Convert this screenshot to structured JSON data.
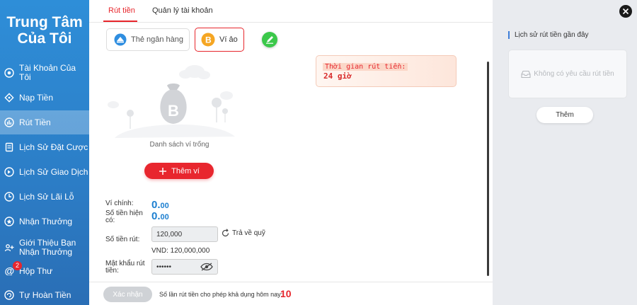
{
  "sidebar": {
    "title_line1": "Trung Tâm",
    "title_line2": "Của Tôi",
    "items": [
      {
        "label": "Tài Khoản Của Tôi",
        "icon": "account-icon"
      },
      {
        "label": "Nạp Tiền",
        "icon": "deposit-icon"
      },
      {
        "label": "Rút Tiền",
        "icon": "withdraw-icon",
        "active": true
      },
      {
        "label": "Lịch Sử Đặt Cược",
        "icon": "bet-history-icon"
      },
      {
        "label": "Lịch Sử Giao Dịch",
        "icon": "transaction-history-icon"
      },
      {
        "label": "Lịch Sử Lãi Lỗ",
        "icon": "profit-loss-icon"
      },
      {
        "label": "Nhận Thưởng",
        "icon": "reward-icon"
      },
      {
        "label": "Giới Thiệu Bạn Nhận Thưởng",
        "icon": "referral-icon"
      },
      {
        "label": "Hộp Thư",
        "icon": "mailbox-icon",
        "badge": "2"
      },
      {
        "label": "Tự Hoàn Tiền",
        "icon": "auto-refund-icon"
      }
    ]
  },
  "tabs": [
    {
      "label": "Rút tiền",
      "active": true
    },
    {
      "label": "Quản lý tài khoản"
    }
  ],
  "methods": {
    "bank_card": "Thẻ ngân hàng",
    "e_wallet": "Ví ảo"
  },
  "notice": {
    "label": "Thời gian rút tiền:",
    "value": "24 giờ"
  },
  "empty_state": {
    "text": "Danh sách ví trống",
    "add_button": "Thêm ví"
  },
  "form": {
    "main_wallet_label": "Ví chính:",
    "main_wallet_int": "0.",
    "main_wallet_dec": "00",
    "current_amount_label_1": "Số tiền hiện",
    "current_amount_label_2": "có:",
    "current_amount_int": "0.",
    "current_amount_dec": "00",
    "withdraw_label": "Số tiền rút:",
    "withdraw_value": "120,000",
    "refund_label": "Trả về quỹ",
    "vnd_text": "VND: 120,000,000",
    "password_label_1": "Mật khẩu rút",
    "password_label_2": "tiền:",
    "password_value": "••••••"
  },
  "footer": {
    "confirm": "Xác nhận",
    "limit_text": "Số lần rút tiền cho phép khả dụng hôm nay:",
    "limit_value": "10"
  },
  "history": {
    "title": "Lịch sử rút tiền gần đây",
    "empty": "Không có yêu cầu rút tiền",
    "more": "Thêm"
  },
  "colors": {
    "brand_red": "#e7262c",
    "sidebar_blue": "#2e8ed8",
    "amount_blue": "#1d7fd0",
    "success_green": "#3bc84a",
    "bitcoin_orange": "#f5a623"
  }
}
